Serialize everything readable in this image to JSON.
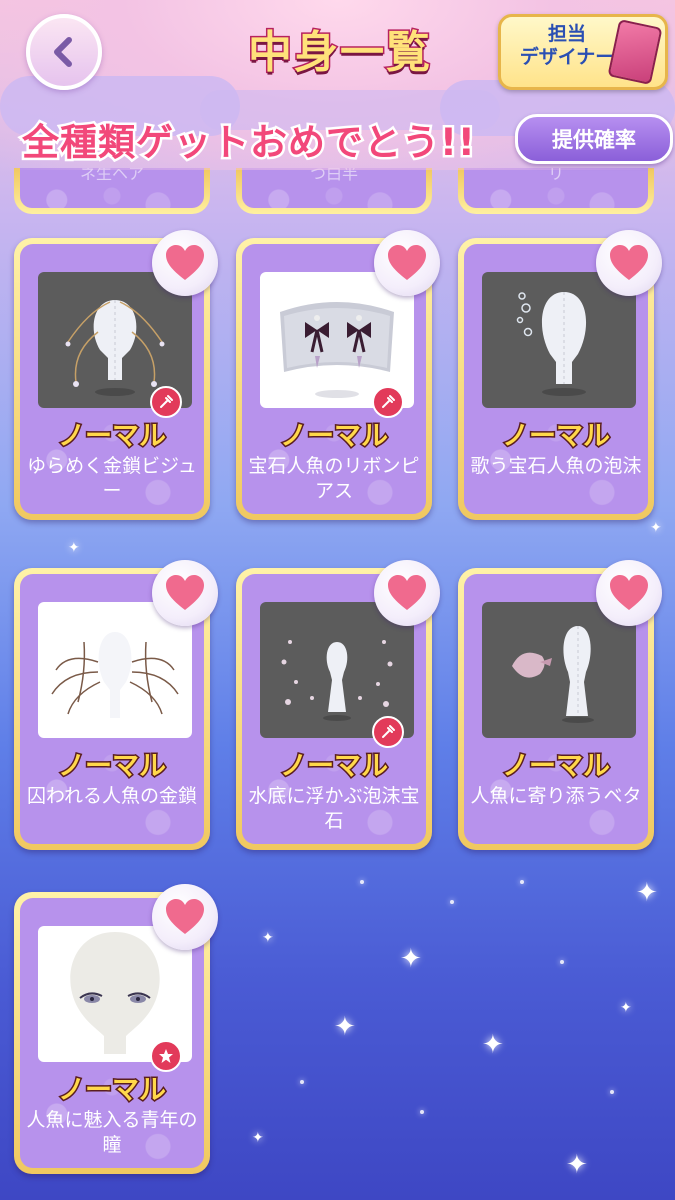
{
  "header": {
    "title": "中身一覧",
    "designer_label": "担当\nデザイナー",
    "complete_banner": "全種類ゲットおめでとう!!",
    "rate_button_label": "提供確率"
  },
  "partial_row": [
    {
      "name": "ネ生ヘア"
    },
    {
      "name": "つ白半"
    },
    {
      "name": "リ"
    }
  ],
  "items": [
    {
      "rarity": "ノーマル",
      "name": "ゆらめく金鎖ビジュー",
      "badge": "dropper-icon",
      "thumb": "dark"
    },
    {
      "rarity": "ノーマル",
      "name": "宝石人魚のリボンピアス",
      "badge": "dropper-icon",
      "thumb": "light"
    },
    {
      "rarity": "ノーマル",
      "name": "歌う宝石人魚の泡沫",
      "badge": "",
      "thumb": "dark"
    },
    {
      "rarity": "ノーマル",
      "name": "囚われる人魚の金鎖",
      "badge": "",
      "thumb": "light"
    },
    {
      "rarity": "ノーマル",
      "name": "水底に浮かぶ泡沫宝石",
      "badge": "dropper-icon",
      "thumb": "dark"
    },
    {
      "rarity": "ノーマル",
      "name": "人魚に寄り添うベタ",
      "badge": "",
      "thumb": "dark"
    },
    {
      "rarity": "ノーマル",
      "name": "人魚に魅入る青年の瞳",
      "badge": "star-icon",
      "thumb": "light"
    }
  ],
  "colors": {
    "heart": "#f06a8e",
    "card_border": "#f0c860",
    "card_body": "#b792ec",
    "rarity_text": "#ffd84a",
    "banner_text": "#f2487a"
  }
}
